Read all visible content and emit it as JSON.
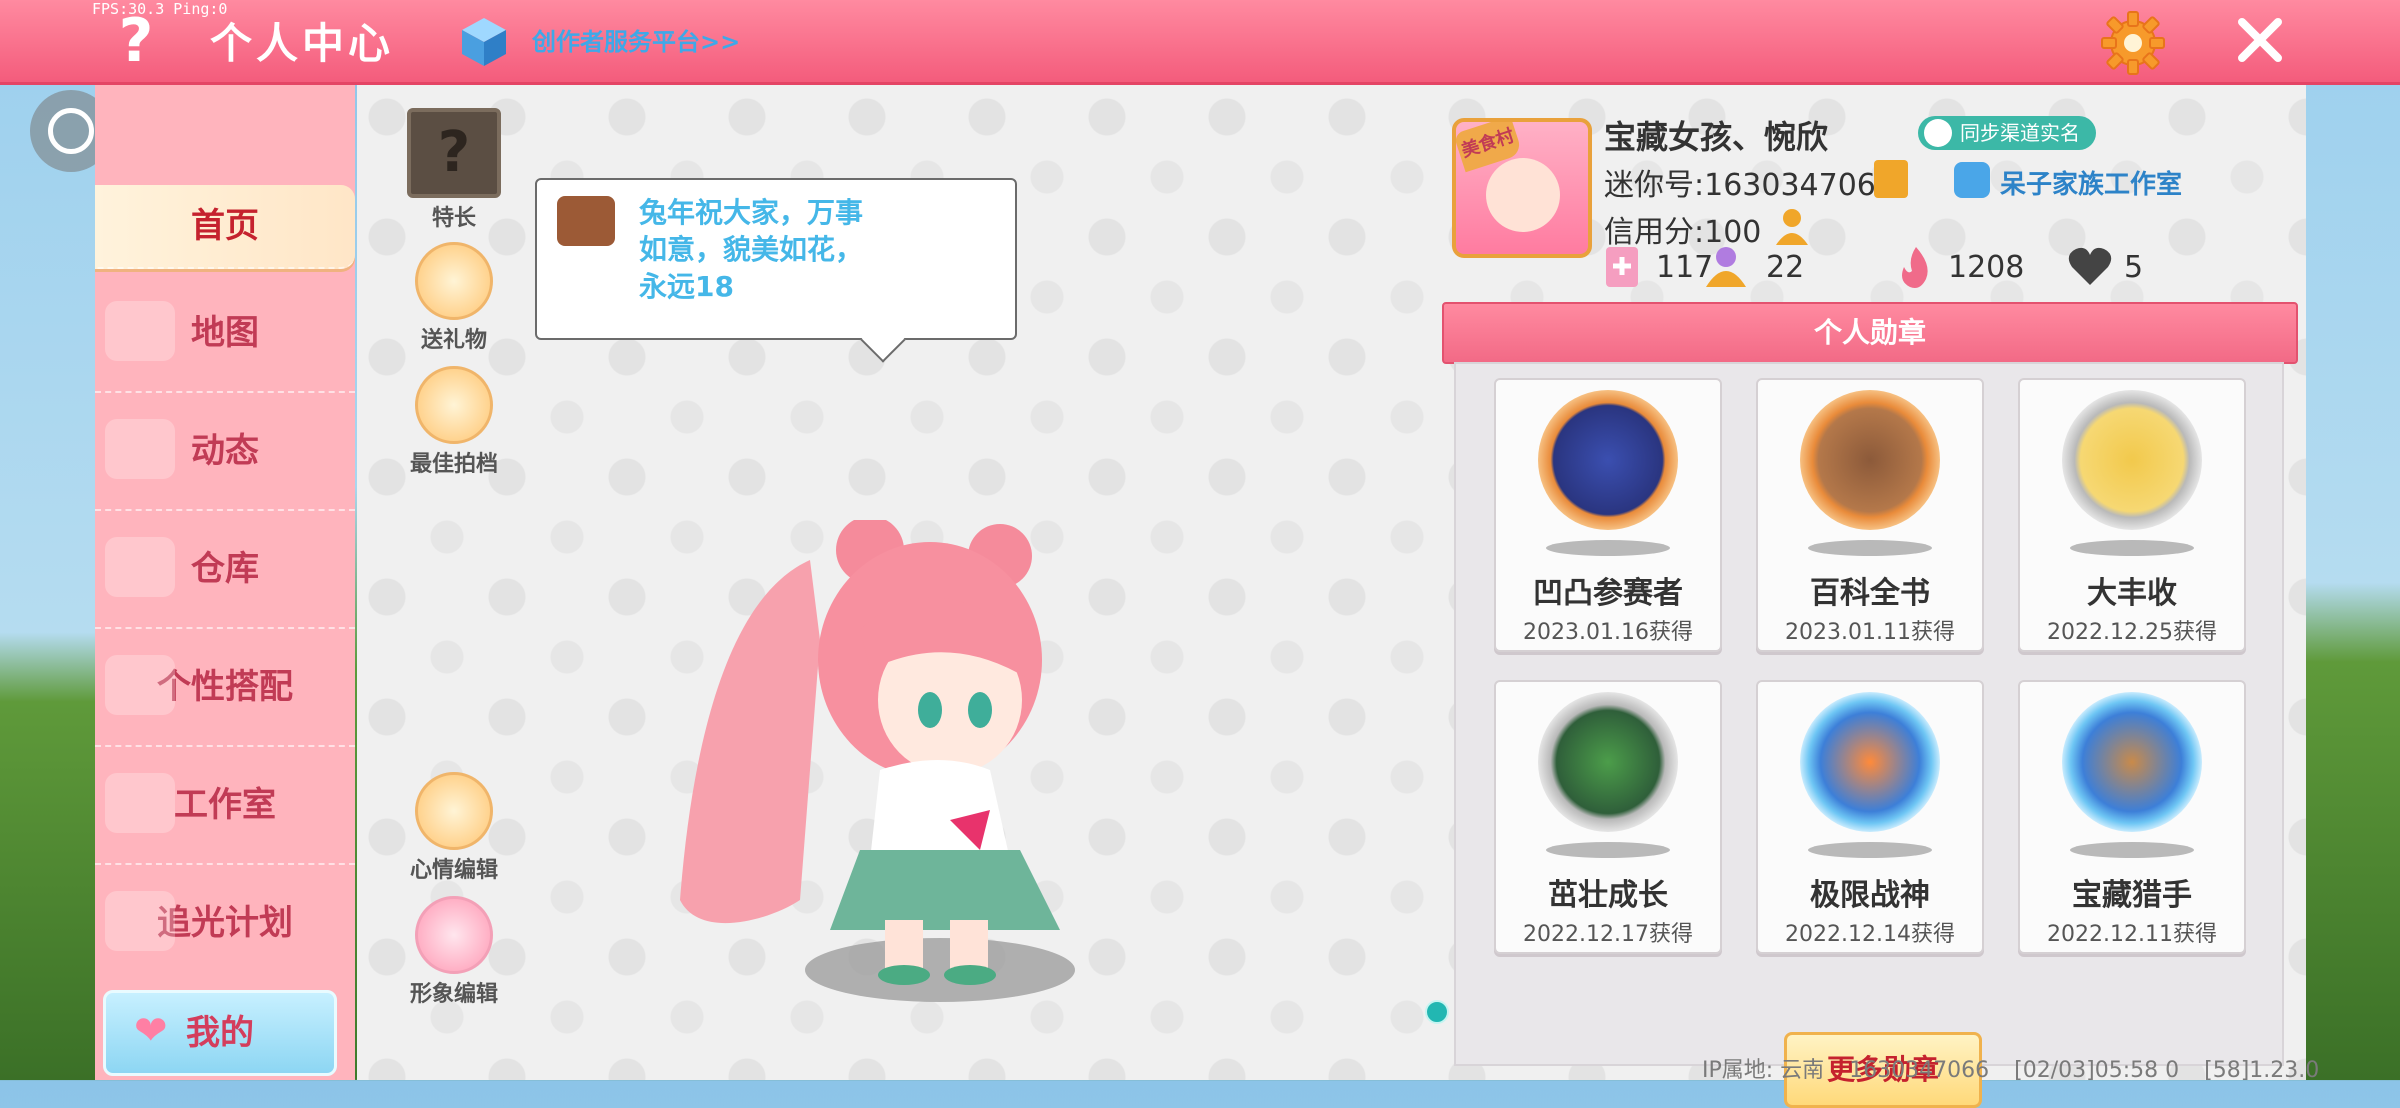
{
  "debug": {
    "fps_text": "FPS:30.3  Ping:0"
  },
  "header": {
    "title": "个人中心",
    "creator_link": "创作者服务平台>>",
    "icons": {
      "help": "question-icon",
      "cube": "cube-icon",
      "settings": "gear-icon",
      "close": "close-icon"
    },
    "accent_color": "#f45c7c"
  },
  "sidebar": {
    "items": [
      {
        "label": "首页",
        "active": true
      },
      {
        "label": "地图"
      },
      {
        "label": "动态"
      },
      {
        "label": "仓库"
      },
      {
        "label": "个性搭配"
      },
      {
        "label": "工作室"
      },
      {
        "label": "追光计划"
      }
    ],
    "mine_button": "我的"
  },
  "actions": {
    "talent": "特长",
    "gift": "送礼物",
    "partner": "最佳拍档",
    "mood_edit": "心情编辑",
    "avatar_edit": "形象编辑"
  },
  "mood": {
    "text": "兔年祝大家，万事如意，貌美如花，永远18"
  },
  "profile": {
    "badge": "美食村",
    "name": "宝藏女孩、惋欣",
    "mini_id": "迷你号:1630347066",
    "credit": "信用分:100",
    "realname_tag": "同步渠道实名",
    "studio": "呆子家族工作室",
    "stats": {
      "level": "117",
      "fans": "22",
      "popularity": "1208",
      "likes": "5"
    }
  },
  "medals": {
    "header": "个人勋章",
    "items": [
      {
        "name": "凹凸参赛者",
        "date": "2023.01.16获得"
      },
      {
        "name": "百科全书",
        "date": "2023.01.11获得"
      },
      {
        "name": "大丰收",
        "date": "2022.12.25获得"
      },
      {
        "name": "茁壮成长",
        "date": "2022.12.17获得"
      },
      {
        "name": "极限战神",
        "date": "2022.12.14获得"
      },
      {
        "name": "宝藏猎手",
        "date": "2022.12.11获得"
      }
    ],
    "more_button": "更多勋章"
  },
  "footer": {
    "ip": "IP属地: 云南",
    "uid": "1630347066",
    "time": "[02/03]05:58 0",
    "version": "[58]1.23.0"
  }
}
